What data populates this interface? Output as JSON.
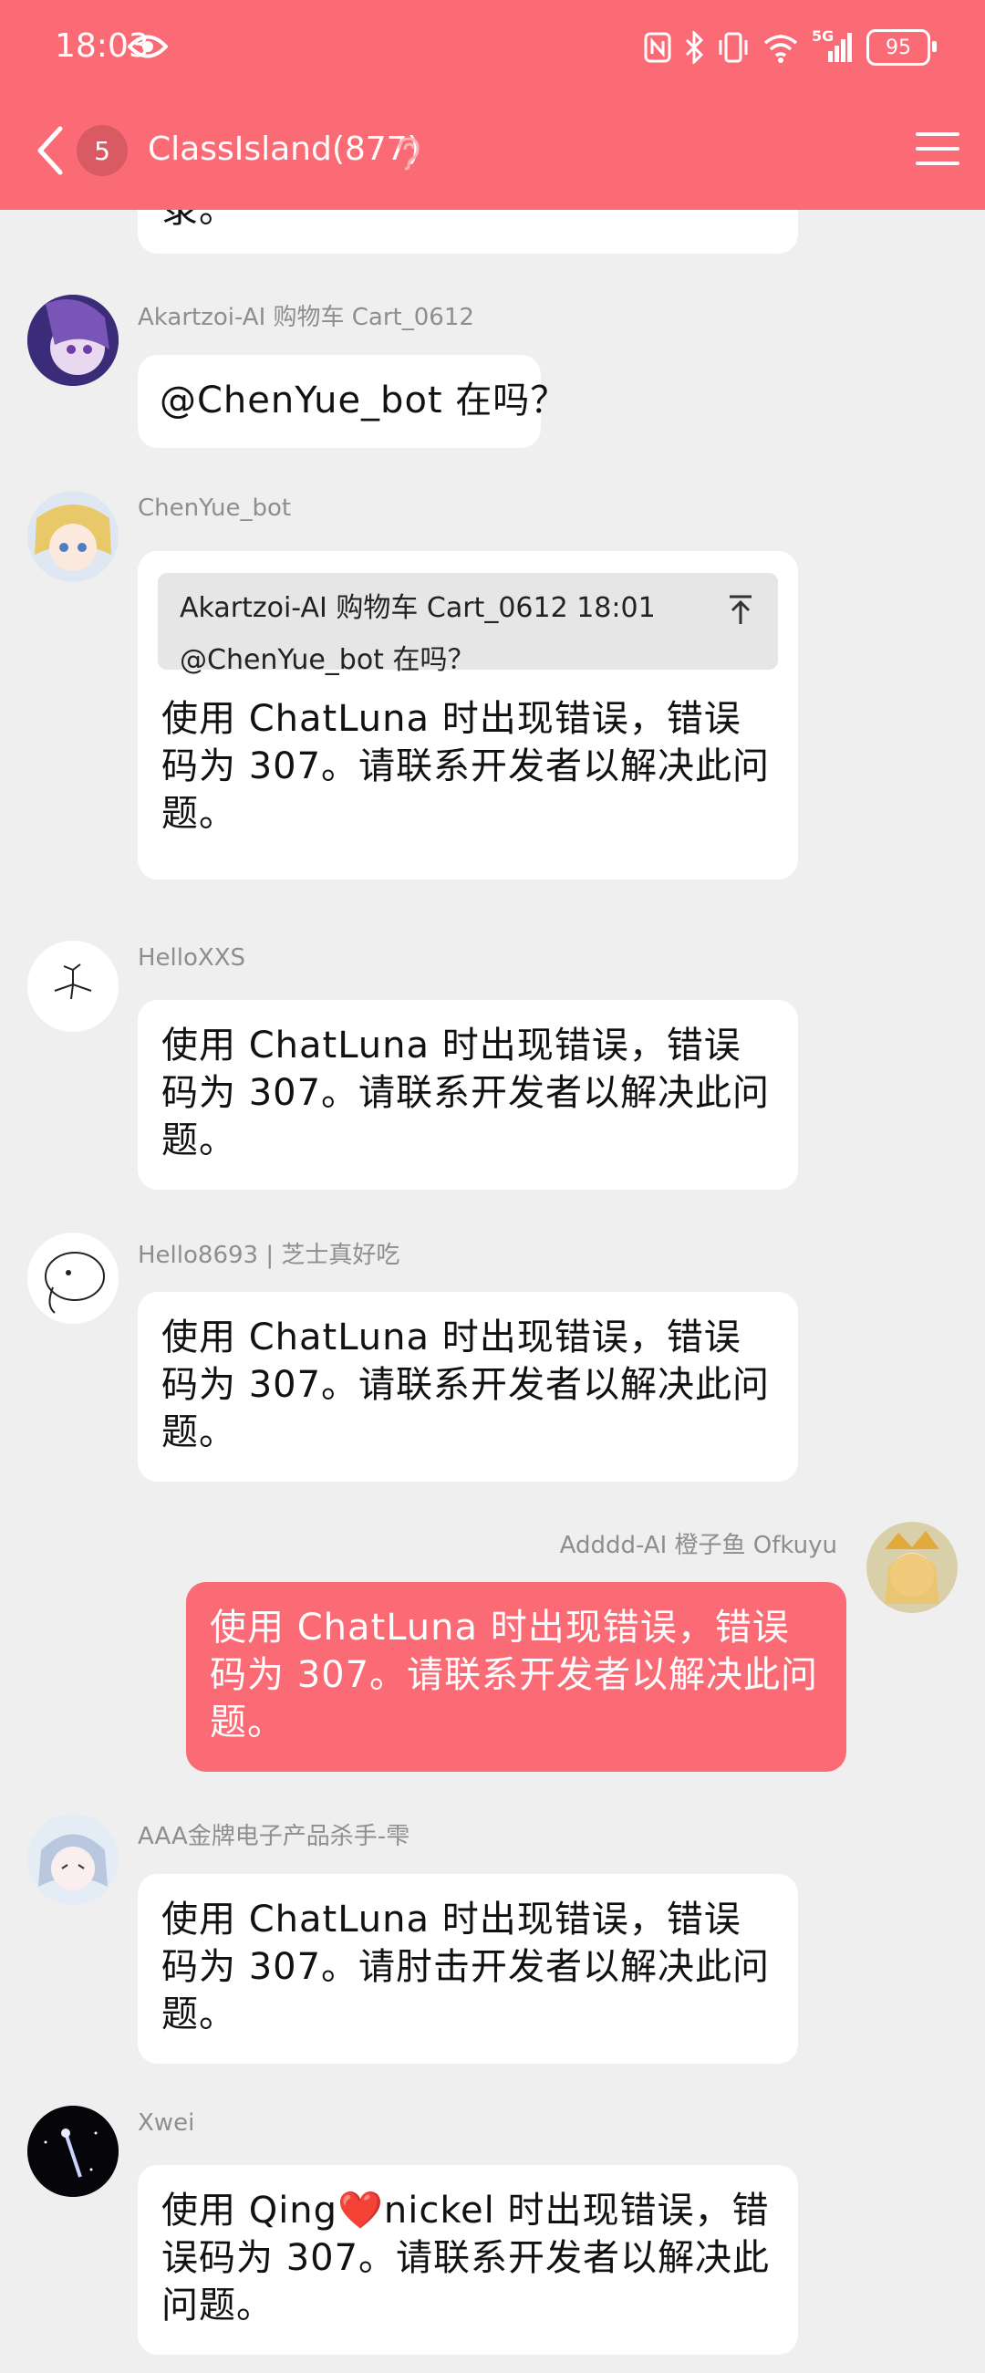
{
  "status_bar": {
    "time": "18:03",
    "battery": "95",
    "signal_label": "5G"
  },
  "header": {
    "back_badge": "5",
    "title": "ClassIsland(877)"
  },
  "messages": [
    {
      "sender": "Akartzoi-AI 购物车 Cart_0612",
      "text": "@ChenYue_bot 在吗？",
      "side": "left"
    },
    {
      "sender": "ChenYue_bot",
      "quote": {
        "header": "Akartzoi-AI 购物车 Cart_0612 18:01",
        "body": "@ChenYue_bot 在吗？"
      },
      "text": "使用 ChatLuna 时出现错误，错误码为 307。请联系开发者以解决此问题。",
      "side": "left"
    },
    {
      "sender": "HelloXXS",
      "text": "使用 ChatLuna 时出现错误，错误码为 307。请联系开发者以解决此问题。",
      "side": "left"
    },
    {
      "sender": "Hello8693 | 芝士真好吃",
      "text": "使用 ChatLuna 时出现错误，错误码为 307。请联系开发者以解决此问题。",
      "side": "left"
    },
    {
      "sender": "Adddd-AI 橙子鱼 Ofkuyu",
      "text": "使用 ChatLuna 时出现错误，错误码为 307。请联系开发者以解决此问题。",
      "side": "right"
    },
    {
      "sender": "AAA金牌电子产品杀手-雫",
      "text": "使用 ChatLuna 时出现错误，错误码为 307。请肘击开发者以解决此问题。",
      "side": "left"
    },
    {
      "sender": "Xwei",
      "text": "使用 Qing❤️nickel 时出现错误，错误码为 307。请联系开发者以解决此问题。",
      "side": "left"
    }
  ],
  "partial_top_text": "录。",
  "colors": {
    "accent": "#fb6b76",
    "background": "#efefef",
    "bubble": "#ffffff"
  }
}
